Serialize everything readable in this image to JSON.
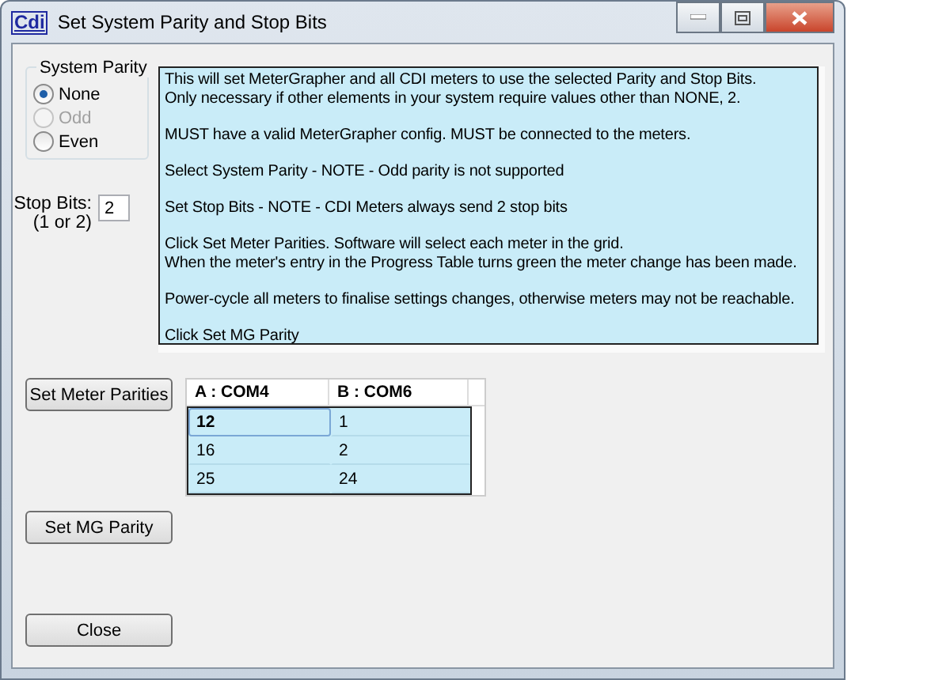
{
  "window": {
    "title": "Set System Parity and Stop Bits",
    "logo": "Cdi"
  },
  "parity": {
    "label": "System Parity",
    "options": [
      {
        "label": "None",
        "selected": true,
        "disabled": false
      },
      {
        "label": "Odd",
        "selected": false,
        "disabled": true
      },
      {
        "label": "Even",
        "selected": false,
        "disabled": false
      }
    ]
  },
  "stop_bits": {
    "label": "Stop Bits:",
    "hint": "(1 or 2)",
    "value": "2"
  },
  "instructions": [
    [
      "This will set MeterGrapher and all CDI meters to use the selected Parity and Stop Bits.",
      "Only necessary if other elements in your system require values other than NONE, 2."
    ],
    [
      "MUST have a valid MeterGrapher config.  MUST be connected to the meters."
    ],
    [
      "Select System Parity - NOTE - Odd parity is not supported"
    ],
    [
      "Set Stop Bits - NOTE - CDI Meters always send 2 stop bits"
    ],
    [
      "Click Set Meter Parities.  Software will select each meter in the grid.",
      "When the meter's entry in the Progress Table turns green the meter change has been made."
    ],
    [
      "Power-cycle all meters to finalise settings changes, otherwise meters may not be reachable."
    ],
    [
      "Click Set MG Parity"
    ]
  ],
  "buttons": [
    "Set Meter Parities",
    "Set MG Parity",
    "Close"
  ],
  "table": {
    "columns": [
      "A : COM4",
      "B : COM6"
    ],
    "rows": [
      {
        "cells": [
          "12",
          "1"
        ],
        "selected": true,
        "focused": true
      },
      {
        "cells": [
          "16",
          "2"
        ],
        "selected": true,
        "focused": false
      },
      {
        "cells": [
          "25",
          "24"
        ],
        "selected": true,
        "focused": false
      }
    ]
  }
}
